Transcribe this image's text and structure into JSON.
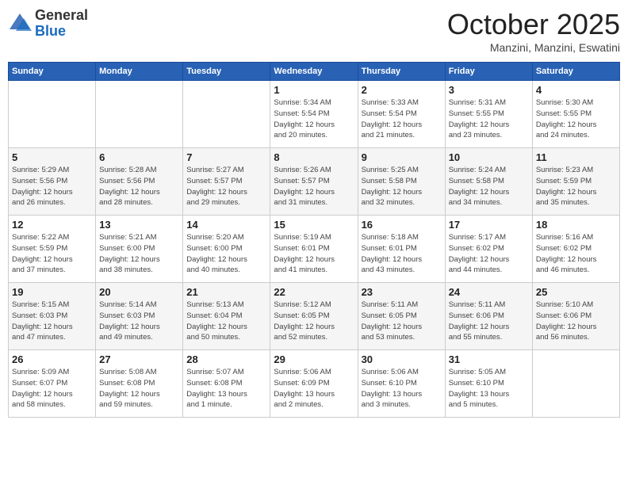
{
  "logo": {
    "general": "General",
    "blue": "Blue"
  },
  "title": "October 2025",
  "location": "Manzini, Manzini, Eswatini",
  "headers": [
    "Sunday",
    "Monday",
    "Tuesday",
    "Wednesday",
    "Thursday",
    "Friday",
    "Saturday"
  ],
  "weeks": [
    [
      {
        "day": "",
        "info": ""
      },
      {
        "day": "",
        "info": ""
      },
      {
        "day": "",
        "info": ""
      },
      {
        "day": "1",
        "info": "Sunrise: 5:34 AM\nSunset: 5:54 PM\nDaylight: 12 hours\nand 20 minutes."
      },
      {
        "day": "2",
        "info": "Sunrise: 5:33 AM\nSunset: 5:54 PM\nDaylight: 12 hours\nand 21 minutes."
      },
      {
        "day": "3",
        "info": "Sunrise: 5:31 AM\nSunset: 5:55 PM\nDaylight: 12 hours\nand 23 minutes."
      },
      {
        "day": "4",
        "info": "Sunrise: 5:30 AM\nSunset: 5:55 PM\nDaylight: 12 hours\nand 24 minutes."
      }
    ],
    [
      {
        "day": "5",
        "info": "Sunrise: 5:29 AM\nSunset: 5:56 PM\nDaylight: 12 hours\nand 26 minutes."
      },
      {
        "day": "6",
        "info": "Sunrise: 5:28 AM\nSunset: 5:56 PM\nDaylight: 12 hours\nand 28 minutes."
      },
      {
        "day": "7",
        "info": "Sunrise: 5:27 AM\nSunset: 5:57 PM\nDaylight: 12 hours\nand 29 minutes."
      },
      {
        "day": "8",
        "info": "Sunrise: 5:26 AM\nSunset: 5:57 PM\nDaylight: 12 hours\nand 31 minutes."
      },
      {
        "day": "9",
        "info": "Sunrise: 5:25 AM\nSunset: 5:58 PM\nDaylight: 12 hours\nand 32 minutes."
      },
      {
        "day": "10",
        "info": "Sunrise: 5:24 AM\nSunset: 5:58 PM\nDaylight: 12 hours\nand 34 minutes."
      },
      {
        "day": "11",
        "info": "Sunrise: 5:23 AM\nSunset: 5:59 PM\nDaylight: 12 hours\nand 35 minutes."
      }
    ],
    [
      {
        "day": "12",
        "info": "Sunrise: 5:22 AM\nSunset: 5:59 PM\nDaylight: 12 hours\nand 37 minutes."
      },
      {
        "day": "13",
        "info": "Sunrise: 5:21 AM\nSunset: 6:00 PM\nDaylight: 12 hours\nand 38 minutes."
      },
      {
        "day": "14",
        "info": "Sunrise: 5:20 AM\nSunset: 6:00 PM\nDaylight: 12 hours\nand 40 minutes."
      },
      {
        "day": "15",
        "info": "Sunrise: 5:19 AM\nSunset: 6:01 PM\nDaylight: 12 hours\nand 41 minutes."
      },
      {
        "day": "16",
        "info": "Sunrise: 5:18 AM\nSunset: 6:01 PM\nDaylight: 12 hours\nand 43 minutes."
      },
      {
        "day": "17",
        "info": "Sunrise: 5:17 AM\nSunset: 6:02 PM\nDaylight: 12 hours\nand 44 minutes."
      },
      {
        "day": "18",
        "info": "Sunrise: 5:16 AM\nSunset: 6:02 PM\nDaylight: 12 hours\nand 46 minutes."
      }
    ],
    [
      {
        "day": "19",
        "info": "Sunrise: 5:15 AM\nSunset: 6:03 PM\nDaylight: 12 hours\nand 47 minutes."
      },
      {
        "day": "20",
        "info": "Sunrise: 5:14 AM\nSunset: 6:03 PM\nDaylight: 12 hours\nand 49 minutes."
      },
      {
        "day": "21",
        "info": "Sunrise: 5:13 AM\nSunset: 6:04 PM\nDaylight: 12 hours\nand 50 minutes."
      },
      {
        "day": "22",
        "info": "Sunrise: 5:12 AM\nSunset: 6:05 PM\nDaylight: 12 hours\nand 52 minutes."
      },
      {
        "day": "23",
        "info": "Sunrise: 5:11 AM\nSunset: 6:05 PM\nDaylight: 12 hours\nand 53 minutes."
      },
      {
        "day": "24",
        "info": "Sunrise: 5:11 AM\nSunset: 6:06 PM\nDaylight: 12 hours\nand 55 minutes."
      },
      {
        "day": "25",
        "info": "Sunrise: 5:10 AM\nSunset: 6:06 PM\nDaylight: 12 hours\nand 56 minutes."
      }
    ],
    [
      {
        "day": "26",
        "info": "Sunrise: 5:09 AM\nSunset: 6:07 PM\nDaylight: 12 hours\nand 58 minutes."
      },
      {
        "day": "27",
        "info": "Sunrise: 5:08 AM\nSunset: 6:08 PM\nDaylight: 12 hours\nand 59 minutes."
      },
      {
        "day": "28",
        "info": "Sunrise: 5:07 AM\nSunset: 6:08 PM\nDaylight: 13 hours\nand 1 minute."
      },
      {
        "day": "29",
        "info": "Sunrise: 5:06 AM\nSunset: 6:09 PM\nDaylight: 13 hours\nand 2 minutes."
      },
      {
        "day": "30",
        "info": "Sunrise: 5:06 AM\nSunset: 6:10 PM\nDaylight: 13 hours\nand 3 minutes."
      },
      {
        "day": "31",
        "info": "Sunrise: 5:05 AM\nSunset: 6:10 PM\nDaylight: 13 hours\nand 5 minutes."
      },
      {
        "day": "",
        "info": ""
      }
    ]
  ]
}
